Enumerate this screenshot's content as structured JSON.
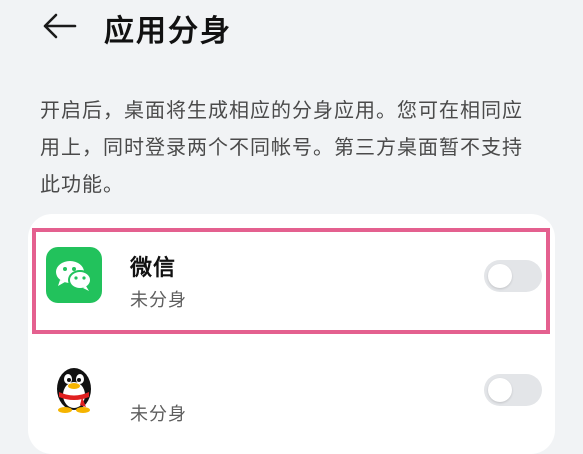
{
  "header": {
    "title": "应用分身",
    "back_icon": "arrow-left-icon"
  },
  "description": "开启后，桌面将生成相应的分身应用。您可在相同应用上，同时登录两个不同帐号。第三方桌面暂不支持此功能。",
  "apps": [
    {
      "name": "微信",
      "status": "未分身",
      "icon": "wechat-icon",
      "toggle_on": false
    },
    {
      "name": "",
      "status": "未分身",
      "icon": "qq-penguin-icon",
      "toggle_on": false
    }
  ],
  "colors": {
    "accent_highlight": "#e4608f",
    "wechat_green": "#22c25c",
    "toggle_off": "#e3e5e8"
  }
}
